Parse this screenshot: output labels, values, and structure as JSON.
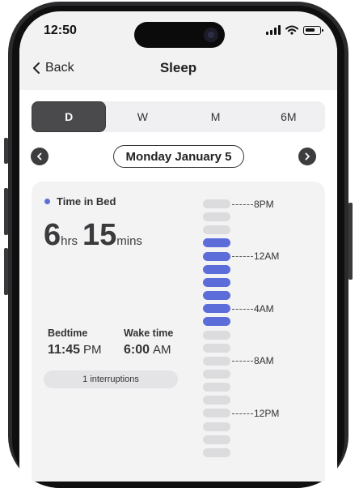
{
  "status": {
    "time": "12:50"
  },
  "nav": {
    "back_label": "Back",
    "title": "Sleep"
  },
  "tabs": [
    {
      "label": "D",
      "active": true
    },
    {
      "label": "W",
      "active": false
    },
    {
      "label": "M",
      "active": false
    },
    {
      "label": "6M",
      "active": false
    }
  ],
  "date": {
    "label": "Monday January 5"
  },
  "card": {
    "legend": "Time in Bed",
    "hours": "6",
    "hours_unit": "hrs",
    "minutes": "15",
    "minutes_unit": "mins",
    "bedtime_label": "Bedtime",
    "bedtime_value": "11:45",
    "bedtime_ampm": "PM",
    "wake_label": "Wake time",
    "wake_value": "6:00",
    "wake_ampm": "AM",
    "interruptions": "1 interruptions"
  },
  "timeline": {
    "labels": [
      "8PM",
      "12AM",
      "4AM",
      "8AM",
      "12PM"
    ],
    "segments": [
      0,
      0,
      0,
      1,
      1,
      1,
      1,
      1,
      1,
      1,
      0,
      0,
      0,
      0,
      0,
      0,
      0,
      0,
      0,
      0
    ]
  },
  "colors": {
    "accent": "#5c6cd8",
    "inactive_segment": "#dcdcde",
    "active_tab": "#4a4a4c"
  }
}
